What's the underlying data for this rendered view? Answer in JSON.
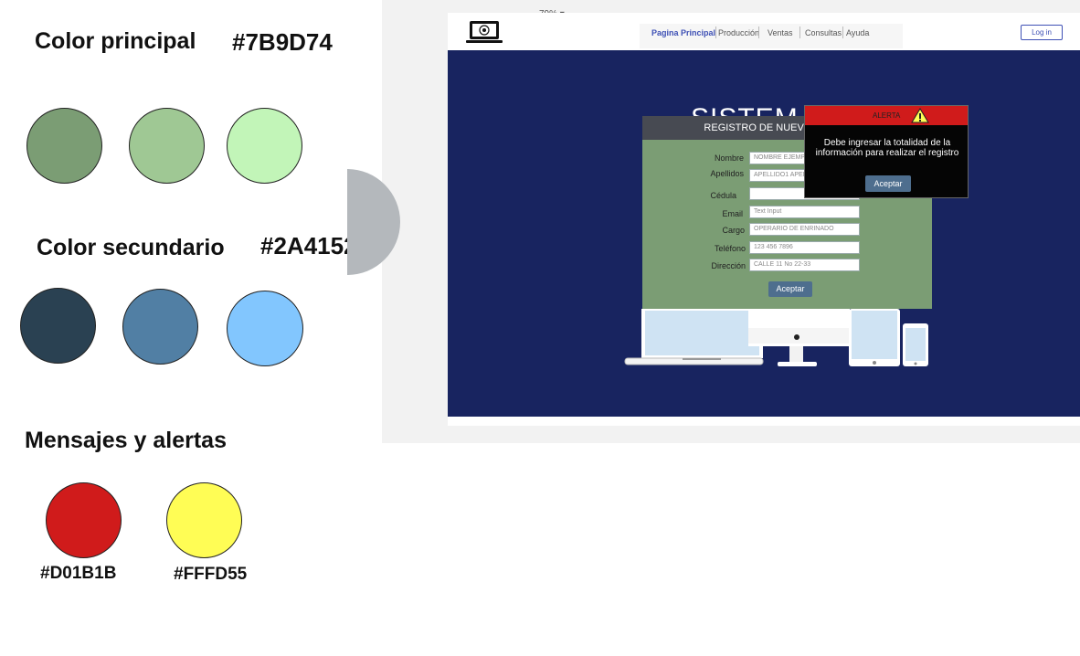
{
  "palette": {
    "primary": {
      "title": "Color principal",
      "hex": "#7B9D74",
      "swatches": [
        "#7b9d74",
        "#9fc894",
        "#c2f5b8"
      ]
    },
    "secondary": {
      "title": "Color secundario",
      "hex": "#2A4152",
      "swatches": [
        "#2a4152",
        "#517fa4",
        "#82c6fe"
      ]
    },
    "alerts": {
      "title": "Mensajes y alertas",
      "items": [
        {
          "color": "#d01b1b",
          "hex": "#D01B1B"
        },
        {
          "color": "#fffd55",
          "hex": "#FFFD55"
        }
      ]
    }
  },
  "preview": {
    "zoom": "79%",
    "nav": {
      "items": [
        "Pagina Principal",
        "Producción",
        "Ventas",
        "Consultas",
        "Ayuda"
      ],
      "login": "Log in"
    },
    "hero_title": "SISTEM R",
    "form": {
      "header": "REGISTRO DE NUEVO EMPLEADO",
      "fields": [
        {
          "label": "Nombre",
          "value": "NOMBRE EJEMPLO"
        },
        {
          "label": "Apellidos",
          "value": "APELLIDO1 APELLIDO2"
        },
        {
          "label": "Cédula",
          "value": ""
        },
        {
          "label": "Email",
          "value": "Text Input"
        },
        {
          "label": "Cargo",
          "value": "OPERARIO DE ENRINADO"
        },
        {
          "label": "Teléfono",
          "value": "123 456 7896"
        },
        {
          "label": "Dirección",
          "value": "CALLE 11 No 22-33"
        }
      ],
      "submit": "Aceptar"
    },
    "alert": {
      "title": "ALERTA",
      "message": "Debe ingresar la totalidad de la información para realizar el registro",
      "button": "Aceptar",
      "icon": "warning-icon"
    }
  }
}
